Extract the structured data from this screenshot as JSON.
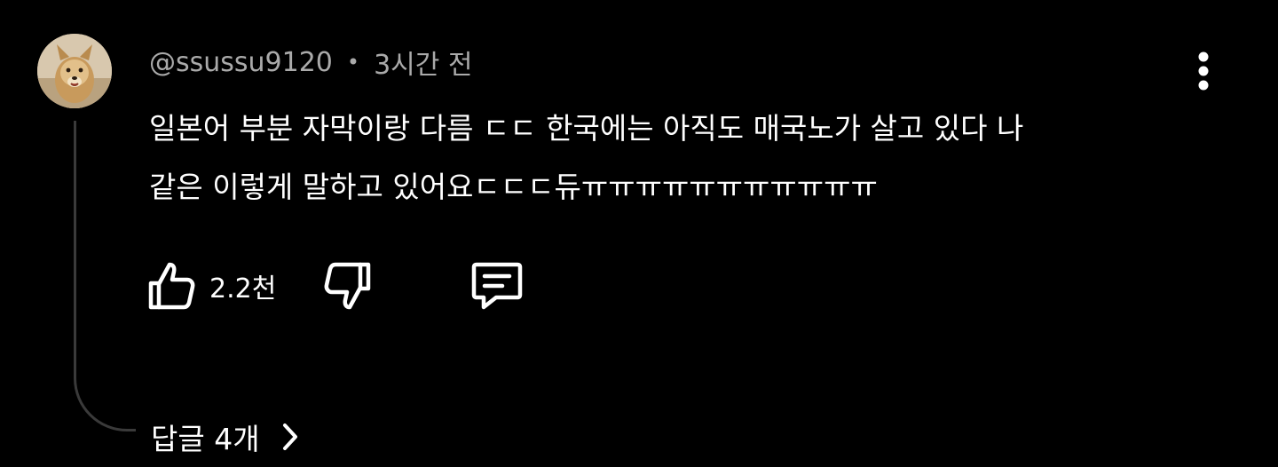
{
  "comment": {
    "author": "@ssussu9120",
    "separator": "•",
    "time": "3시간 전",
    "text": "일본어 부분 자막이랑 다름 ㄷㄷ 한국에는 아직도 매국노가 살고 있다 나\n같은 이렇게 말하고 있어요ㄷㄷㄷ듀ㅠㅠㅠㅠㅠㅠㅠㅠㅠㅠㅠ",
    "like_count": "2.2천",
    "replies_label": "답글 4개"
  },
  "icons": {
    "avatar": "dog-avatar",
    "menu": "more-vert-icon",
    "like": "thumbs-up-icon",
    "dislike": "thumbs-down-icon",
    "reply": "comment-icon",
    "expand": "chevron-right-icon"
  },
  "colors": {
    "background": "#000000",
    "text_primary": "#ffffff",
    "text_secondary": "#aaaaaa",
    "thread_line": "#3a3a3a"
  }
}
